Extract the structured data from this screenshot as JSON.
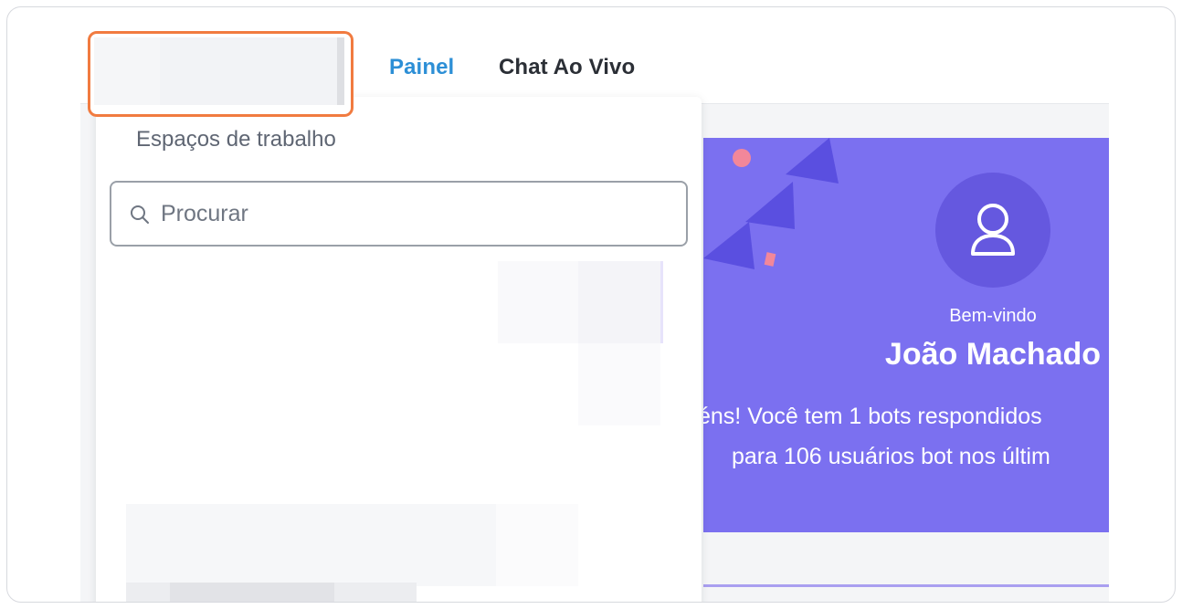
{
  "nav": {
    "tabs": [
      {
        "label": "Painel",
        "active": true
      },
      {
        "label": "Chat Ao Vivo",
        "active": false
      }
    ]
  },
  "workspace_menu": {
    "heading": "Espaços de trabalho",
    "search": {
      "placeholder": "Procurar",
      "value": ""
    }
  },
  "welcome_banner": {
    "greeting": "Bem-vindo",
    "user_name": "João Machado",
    "stats_line_1": "éns! Você tem 1 bots respondidos",
    "stats_line_2": "para 106 usuários bot nos últim",
    "avatar_icon": "user-icon"
  },
  "colors": {
    "accent": "#2d8fd6",
    "selector_highlight": "#f17b40",
    "banner_bg": "#7b70f0",
    "banner_dark": "#6558df"
  }
}
